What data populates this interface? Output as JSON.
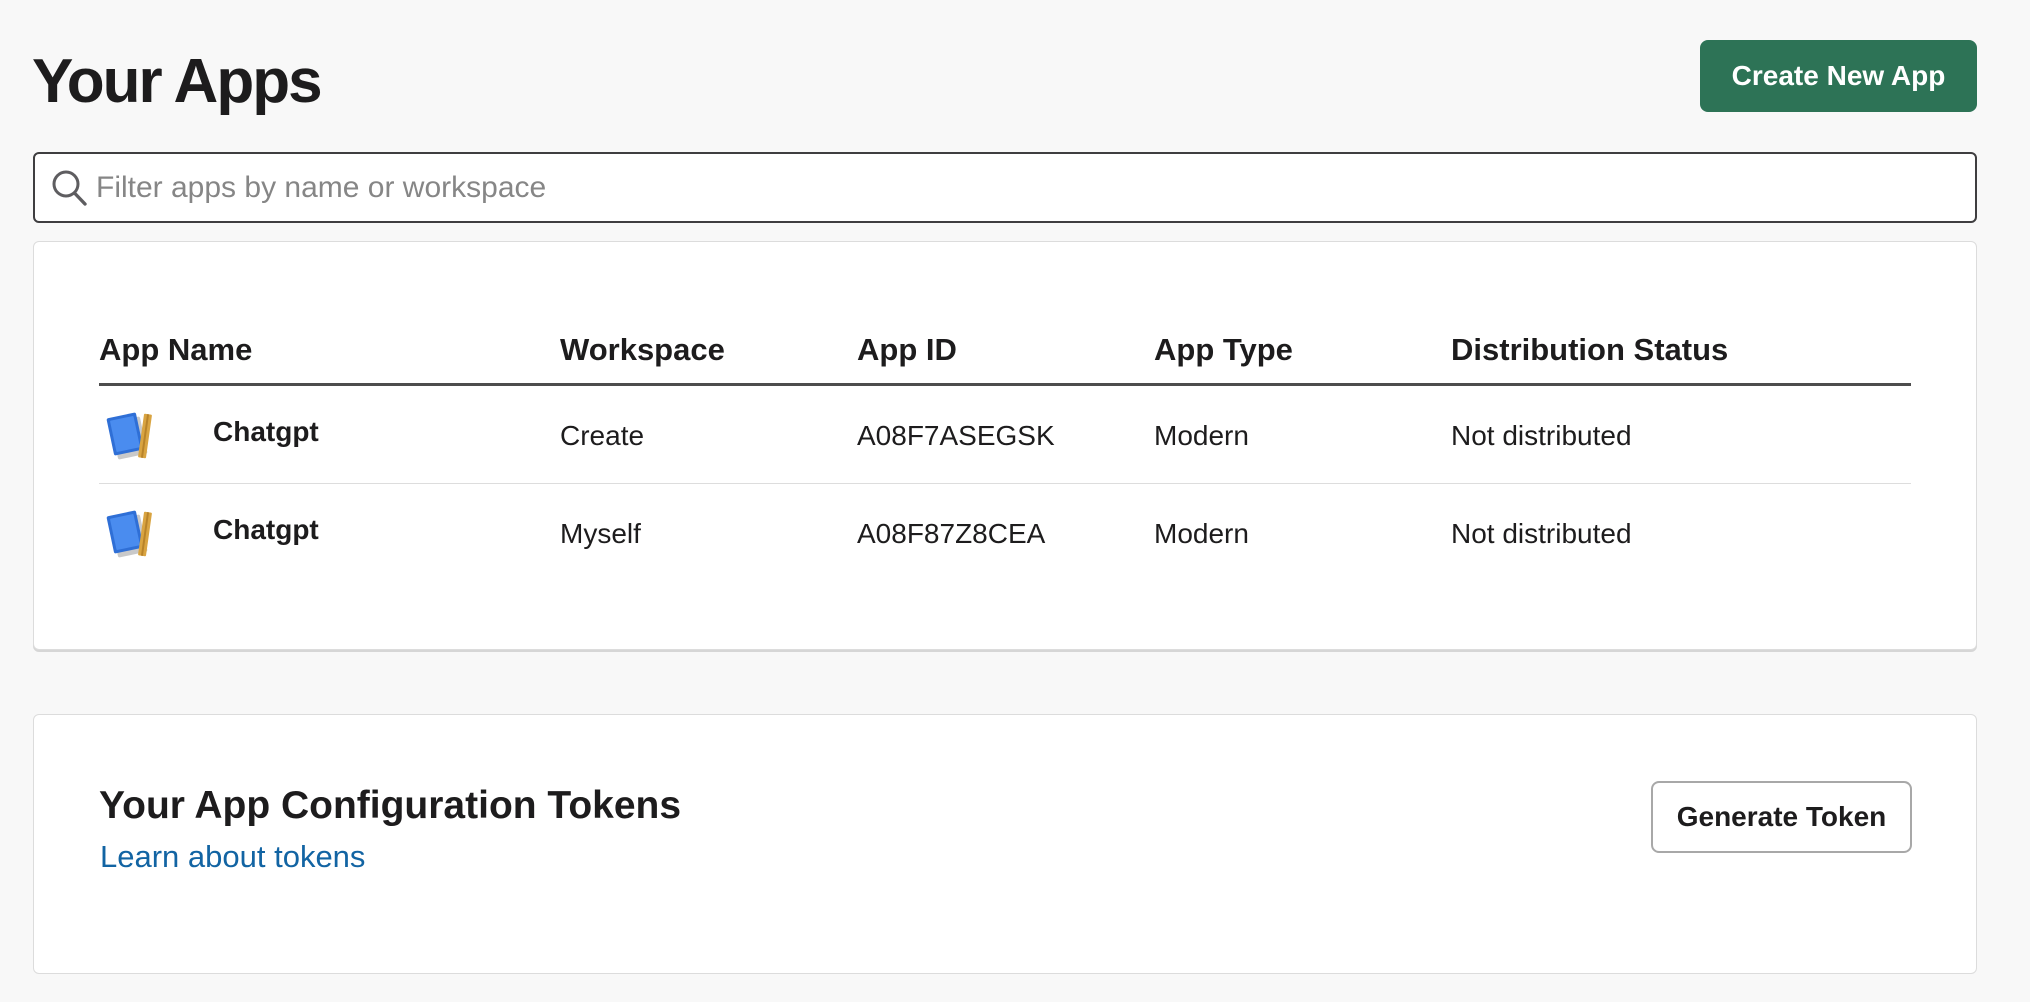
{
  "header": {
    "title": "Your Apps",
    "create_button_label": "Create New App"
  },
  "search": {
    "placeholder": "Filter apps by name or workspace",
    "value": ""
  },
  "apps_table": {
    "columns": [
      "App Name",
      "Workspace",
      "App ID",
      "App Type",
      "Distribution Status"
    ],
    "rows": [
      {
        "icon": "notebook-pencil-icon",
        "app_name": "Chatgpt",
        "workspace": "Create",
        "app_id": "A08F7ASEGSK",
        "app_type": "Modern",
        "distribution_status": "Not distributed"
      },
      {
        "icon": "notebook-pencil-icon",
        "app_name": "Chatgpt",
        "workspace": "Myself",
        "app_id": "A08F87Z8CEA",
        "app_type": "Modern",
        "distribution_status": "Not distributed"
      }
    ]
  },
  "tokens": {
    "title": "Your App Configuration Tokens",
    "link_label": "Learn about tokens",
    "generate_button_label": "Generate Token"
  },
  "colors": {
    "primary_button": "#2d7356",
    "link": "#1264a3",
    "page_background": "#f8f8f8",
    "card_background": "#ffffff",
    "text": "#1d1c1d"
  }
}
